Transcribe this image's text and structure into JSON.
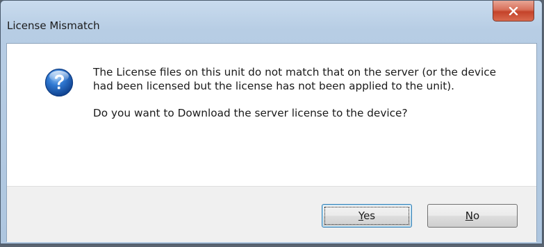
{
  "window": {
    "title": "License Mismatch",
    "close_icon": "close-icon"
  },
  "message": {
    "icon": "question-icon",
    "body": "The License files on this unit do not match that on the server (or the device had been licensed but the license has not been applied to the unit).",
    "question": "Do you want to Download the server license to the device?"
  },
  "buttons": {
    "yes": {
      "mnemonic": "Y",
      "rest": "es"
    },
    "no": {
      "mnemonic": "N",
      "rest": "o"
    }
  }
}
